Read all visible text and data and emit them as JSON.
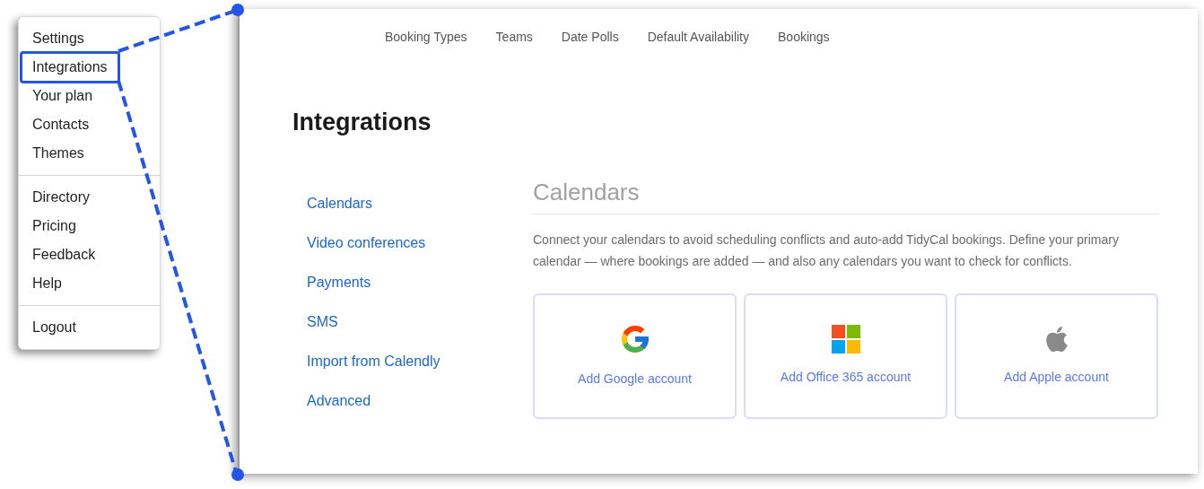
{
  "menu": {
    "sections": [
      [
        {
          "label": "Settings",
          "selected": false
        },
        {
          "label": "Integrations",
          "selected": true
        },
        {
          "label": "Your plan",
          "selected": false
        },
        {
          "label": "Contacts",
          "selected": false
        },
        {
          "label": "Themes",
          "selected": false
        }
      ],
      [
        {
          "label": "Directory",
          "selected": false
        },
        {
          "label": "Pricing",
          "selected": false
        },
        {
          "label": "Feedback",
          "selected": false
        },
        {
          "label": "Help",
          "selected": false
        }
      ],
      [
        {
          "label": "Logout",
          "selected": false
        }
      ]
    ]
  },
  "top_nav": [
    "Booking Types",
    "Teams",
    "Date Polls",
    "Default Availability",
    "Bookings"
  ],
  "page_title": "Integrations",
  "side_nav": [
    "Calendars",
    "Video conferences",
    "Payments",
    "SMS",
    "Import from Calendly",
    "Advanced"
  ],
  "section": {
    "heading": "Calendars",
    "description": "Connect your calendars to avoid scheduling conflicts and auto-add TidyCal bookings. Define your primary calendar — where bookings are added — and also any calendars you want to check for conflicts.",
    "cards": [
      {
        "kind": "google",
        "label": "Add Google account"
      },
      {
        "kind": "office",
        "label": "Add Office 365 account"
      },
      {
        "kind": "apple",
        "label": "Add Apple account"
      }
    ]
  }
}
